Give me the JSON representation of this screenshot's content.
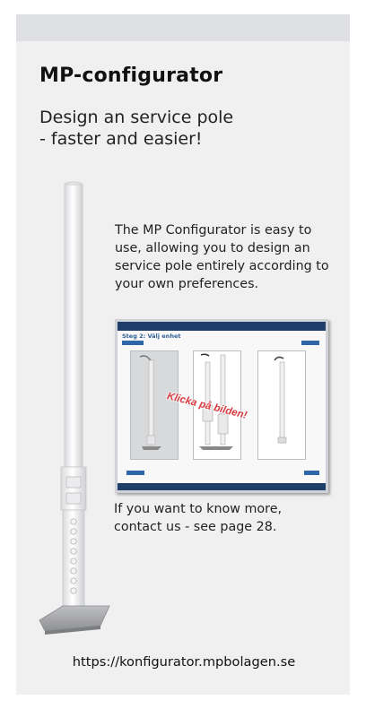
{
  "title": "MP-configurator",
  "subtitle_line1": "Design an service pole",
  "subtitle_line2": "- faster and easier!",
  "intro_text": "The MP Configurator is easy to use, allowing you to design an service pole entirely according to your own preferences.",
  "screenshot": {
    "heading": "Steg 2: Välj enhet",
    "overlay_text": "Klicka på bilden!"
  },
  "more_line1": "If you want to know more,",
  "more_line2": "contact us - see page 28.",
  "url": "https://konfigurator.mpbolagen.se",
  "colors": {
    "card_bg": "#f0f0f0",
    "top_band": "#dfe0e4",
    "ui_header": "#1f3f6a",
    "ui_accent": "#2d67a8",
    "overlay_red": "#d83a40"
  }
}
